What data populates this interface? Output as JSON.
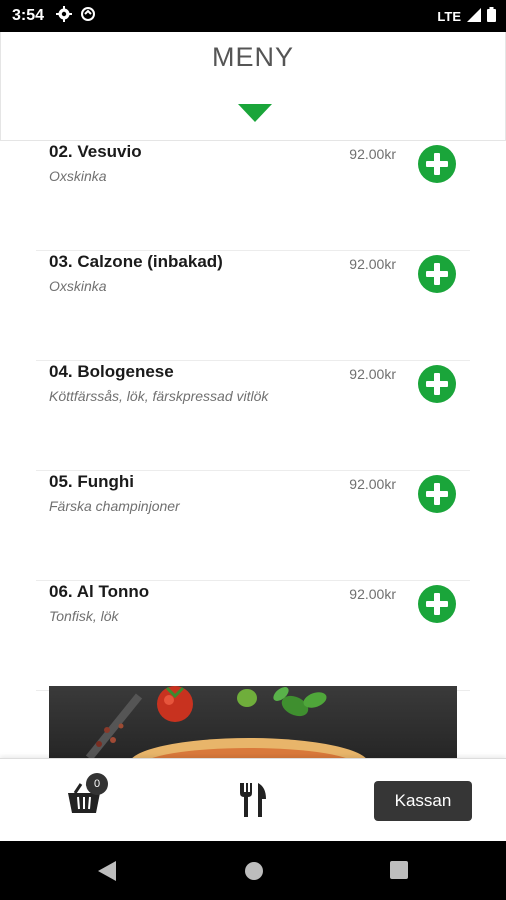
{
  "status_bar": {
    "time": "3:54",
    "network": "LTE"
  },
  "header": {
    "title": "MENY"
  },
  "menu_items": [
    {
      "name": "02. Vesuvio",
      "description": "Oxskinka",
      "price": "92.00kr"
    },
    {
      "name": "03. Calzone (inbakad)",
      "description": "Oxskinka",
      "price": "92.00kr"
    },
    {
      "name": "04. Bologenese",
      "description": "Köttfärssås, lök, färskpressad vitlök",
      "price": "92.00kr"
    },
    {
      "name": "05. Funghi",
      "description": "Färska champinjoner",
      "price": "92.00kr"
    },
    {
      "name": "06. Al Tonno",
      "description": "Tonfisk, lök",
      "price": "92.00kr"
    }
  ],
  "bottom_bar": {
    "cart_count": "0",
    "checkout_label": "Kassan"
  },
  "colors": {
    "accent_green": "#1aa53a",
    "button_dark": "#363636"
  },
  "icons": [
    "settings-icon",
    "sync-icon",
    "signal-icon",
    "battery-icon",
    "dropdown-arrow-icon",
    "add-icon",
    "cart-icon",
    "cutlery-icon",
    "back-icon",
    "home-icon",
    "recents-icon"
  ]
}
